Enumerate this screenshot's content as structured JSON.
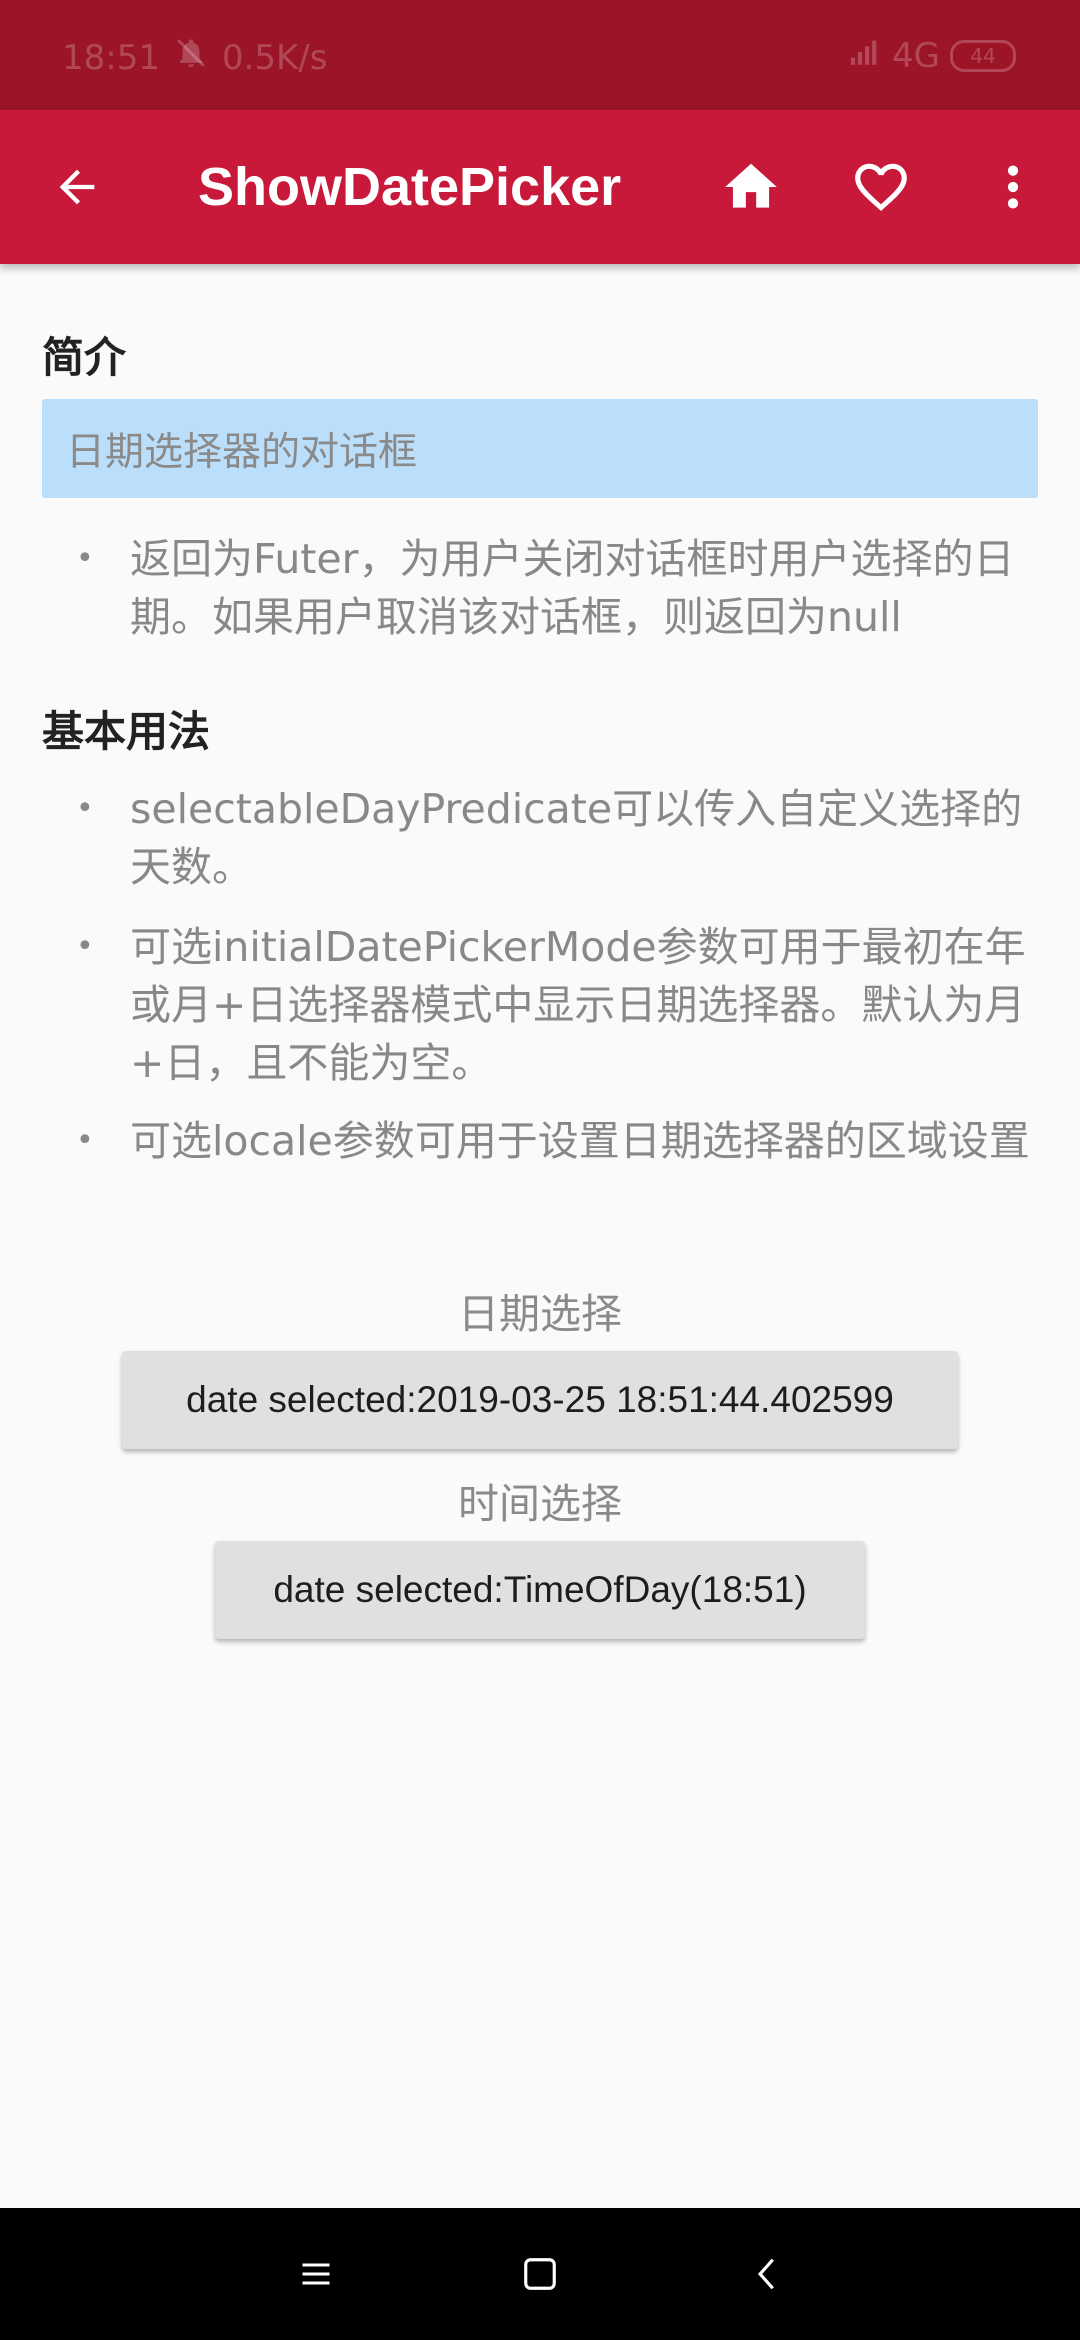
{
  "status_bar": {
    "time": "18:51",
    "net_speed": "0.5K/s",
    "network": "4G",
    "battery": "44"
  },
  "app_bar": {
    "title": "ShowDatePicker"
  },
  "intro": {
    "heading": "简介",
    "summary": "日期选择器的对话框",
    "bullets": [
      "返回为Futer，为用户关闭对话框时用户选择的日期。如果用户取消该对话框，则返回为null"
    ]
  },
  "usage": {
    "heading": "基本用法",
    "bullets": [
      "selectableDayPredicate可以传入自定义选择的天数。",
      "可选initialDatePickerMode参数可用于最初在年或月+日选择器模式中显示日期选择器。默认为月+日，且不能为空。",
      "可选locale参数可用于设置日期选择器的区域设置"
    ]
  },
  "date_picker": {
    "label": "日期选择",
    "button_label": "date selected:2019-03-25 18:51:44.402599"
  },
  "time_picker": {
    "label": "时间选择",
    "button_label": "date selected:TimeOfDay(18:51)"
  },
  "bullet_glyph": "•",
  "colors": {
    "status_bar": "#9b1428",
    "app_bar": "#c8193a",
    "intro_box": "#bbdefb",
    "button": "#e0e0e0"
  },
  "icons": {
    "back": "arrow-left-icon",
    "home": "home-icon",
    "favorite": "heart-outline-icon",
    "more": "more-vertical-icon",
    "nav_menu": "menu-icon",
    "nav_home": "square-icon",
    "nav_back": "chevron-left-icon"
  }
}
